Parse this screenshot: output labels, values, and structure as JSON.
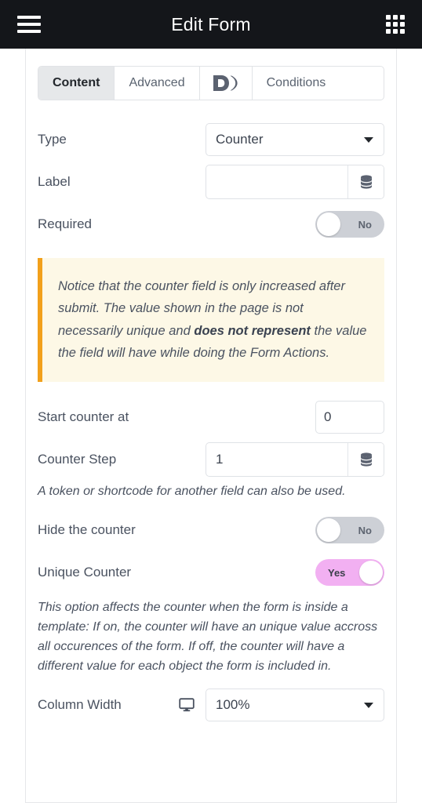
{
  "topbar": {
    "title": "Edit Form",
    "menu_icon": "hamburger-icon",
    "apps_icon": "grid-apps-icon"
  },
  "tabs": [
    {
      "label": "Content",
      "active": true
    },
    {
      "label": "Advanced",
      "active": false
    },
    {
      "label": "D)",
      "active": false,
      "is_logo": true
    },
    {
      "label": "Conditions",
      "active": false
    }
  ],
  "fields": {
    "type": {
      "label": "Type",
      "value": "Counter",
      "control": "select"
    },
    "field_label": {
      "label": "Label",
      "value": "",
      "placeholder": "",
      "control": "text-with-token"
    },
    "required": {
      "label": "Required",
      "value": "No",
      "on": false,
      "control": "switch"
    },
    "start_counter_at": {
      "label": "Start counter at",
      "value": "0",
      "control": "number"
    },
    "counter_step": {
      "label": "Counter Step",
      "value": "1",
      "control": "text-with-token",
      "help": "A token or shortcode for another field can also be used."
    },
    "hide_the_counter": {
      "label": "Hide the counter",
      "value": "No",
      "on": false,
      "control": "switch"
    },
    "unique_counter": {
      "label": "Unique Counter",
      "value": "Yes",
      "on": true,
      "control": "switch",
      "help": "This option affects the counter when the form is inside a template: If on, the counter will have an unique value accross all occurences of the form. If off, the counter will have a different value for each object the form is included in."
    },
    "column_width": {
      "label": "Column Width",
      "value": "100%",
      "device_icon": "desktop-monitor-icon",
      "control": "select"
    }
  },
  "notice": {
    "text_1": "Notice that the counter field is only increased after submit. The value shown in the page is not necessarily unique and ",
    "text_bold": "does not represent",
    "text_2": " the value the field will have while doing the Form Actions."
  },
  "colors": {
    "topbar_bg": "#14161a",
    "accent_on": "#f2b0f2",
    "switch_off": "#cdd0d6",
    "notice_bg": "#fdf8e6",
    "notice_border": "#f2a01b",
    "tab_active_bg": "#e6e8ea",
    "text": "#4a5260"
  }
}
